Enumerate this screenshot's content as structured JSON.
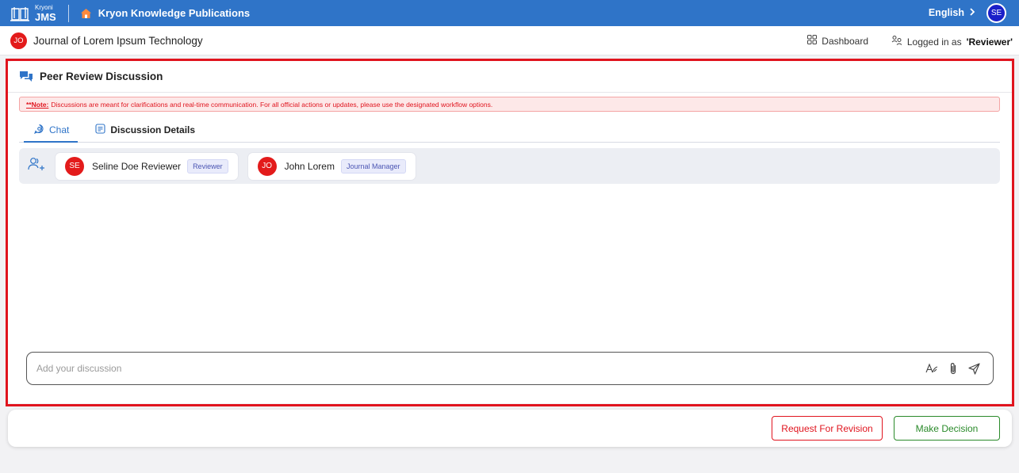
{
  "topbar": {
    "logo_small": "Kryoni",
    "logo_big": "JMS",
    "org_name": "Kryon Knowledge Publications",
    "language": "English",
    "user_initials": "SE"
  },
  "subheader": {
    "journal_initials": "JO",
    "journal_title": "Journal of Lorem Ipsum Technology",
    "dashboard_label": "Dashboard",
    "login_prefix": "Logged in as",
    "login_role": "'Reviewer'"
  },
  "panel": {
    "title": "Peer Review Discussion",
    "note_prefix": "**Note:",
    "note_text": "Discussions are meant for clarifications and real-time communication. For all official actions or updates, please use the designated workflow options.",
    "tabs": [
      {
        "label": "Chat",
        "active": true
      },
      {
        "label": "Discussion Details",
        "active": false
      }
    ],
    "participants": [
      {
        "initials": "SE",
        "name": "Seline Doe Reviewer",
        "role": "Reviewer"
      },
      {
        "initials": "JO",
        "name": "John Lorem",
        "role": "Journal Manager"
      }
    ],
    "composer": {
      "placeholder": "Add your discussion"
    }
  },
  "actions": {
    "revision_label": "Request For Revision",
    "decision_label": "Make Decision"
  },
  "colors": {
    "brand": "#2f74c8",
    "danger": "#e0141e",
    "success": "#2a8a2a",
    "avatar_red": "#e31b1b",
    "avatar_blue": "#1a1fc9"
  },
  "icons": [
    "book-logo-icon",
    "home-icon",
    "chevron-right-icon",
    "grid-icon",
    "user-switch-icon",
    "chat-bubble-icon",
    "chat-icon",
    "document-icon",
    "add-users-icon",
    "text-format-icon",
    "paperclip-icon",
    "send-icon"
  ]
}
